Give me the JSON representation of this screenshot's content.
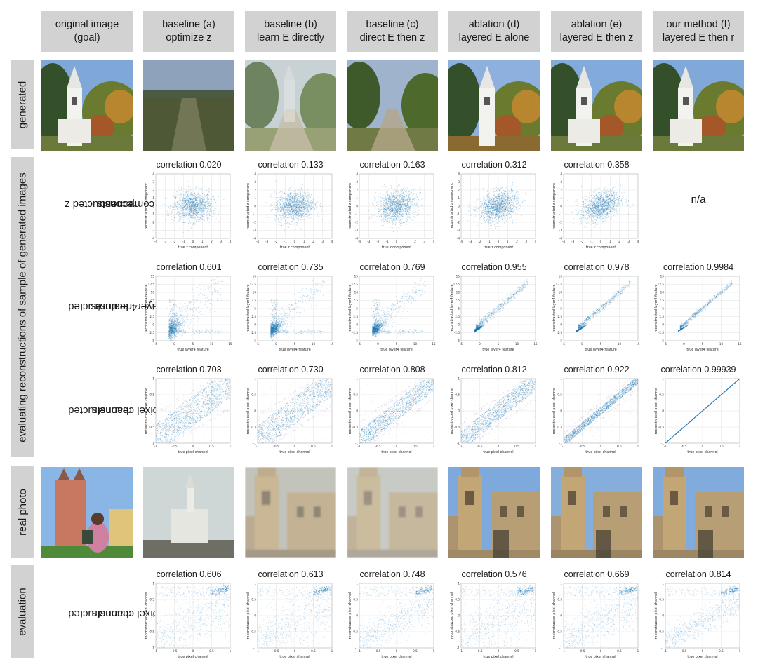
{
  "headers": [
    {
      "line1": "original image",
      "line2": "(goal)"
    },
    {
      "line1": "baseline (a)",
      "line2": "optimize z"
    },
    {
      "line1": "baseline (b)",
      "line2": "learn E directly"
    },
    {
      "line1": "baseline (c)",
      "line2": "direct E then z"
    },
    {
      "line1": "ablation (d)",
      "line2": "layered E alone"
    },
    {
      "line1": "ablation (e)",
      "line2": "layered E then z"
    },
    {
      "line1": "our method (f)",
      "line2": "layered E then r"
    }
  ],
  "row_labels": {
    "generated": "generated",
    "evaluating": "evaluating reconstructions of sample of generated images",
    "real_photo": "real photo",
    "evaluation": "evaluation"
  },
  "sub_labels": {
    "z": [
      "reconstructed z",
      "components"
    ],
    "layer4": [
      "reconstructed",
      "layer4 features"
    ],
    "pixel": [
      "reconstructed",
      "pixel channels"
    ],
    "eval_pixel": [
      "reconstructed",
      "pixel channels"
    ]
  },
  "na_text": "n/a",
  "axis_labels": {
    "z": {
      "x": "true z component",
      "y": "reconstructed z component"
    },
    "layer4": {
      "x": "true layer4 feature",
      "y": "reconstructed layer4 feature"
    },
    "pixel": {
      "x": "true pixel channel",
      "y": "reconstructed pixel channel"
    }
  },
  "colors": {
    "point": "#1f77b4",
    "grey_cloud": "#999999",
    "purple_fringe": "#a070c8",
    "label_bg": "#d2d2d2"
  },
  "chart_data": [
    {
      "type": "scatter",
      "row": "reconstructed z components",
      "xlim": [
        -4,
        4
      ],
      "ylim": [
        -4,
        4
      ],
      "x_ticks": [
        -4,
        -3,
        -2,
        -1,
        0,
        1,
        2,
        3,
        4
      ],
      "y_ticks": [
        -4,
        -3,
        -2,
        -1,
        0,
        1,
        2,
        3,
        4
      ],
      "series": [
        {
          "method": "a",
          "correlation": "correlation 0.020",
          "value": 0.02
        },
        {
          "method": "b",
          "correlation": "correlation 0.133",
          "value": 0.133
        },
        {
          "method": "c",
          "correlation": "correlation 0.163",
          "value": 0.163
        },
        {
          "method": "d",
          "correlation": "correlation 0.312",
          "value": 0.312
        },
        {
          "method": "e",
          "correlation": "correlation 0.358",
          "value": 0.358
        }
      ]
    },
    {
      "type": "scatter",
      "row": "reconstructed layer4 features",
      "xlim": [
        -5,
        15
      ],
      "ylim": [
        -5,
        15
      ],
      "x_ticks": [
        -5,
        0,
        5,
        10,
        15
      ],
      "y_ticks": [
        -5.0,
        -2.5,
        0.0,
        2.5,
        5.0,
        7.5,
        10.0,
        12.5,
        15.0
      ],
      "series": [
        {
          "method": "a",
          "correlation": "correlation 0.601",
          "value": 0.601
        },
        {
          "method": "b",
          "correlation": "correlation 0.735",
          "value": 0.735
        },
        {
          "method": "c",
          "correlation": "correlation 0.769",
          "value": 0.769
        },
        {
          "method": "d",
          "correlation": "correlation 0.955",
          "value": 0.955
        },
        {
          "method": "e",
          "correlation": "correlation 0.978",
          "value": 0.978
        },
        {
          "method": "f",
          "correlation": "correlation 0.9984",
          "value": 0.9984
        }
      ]
    },
    {
      "type": "scatter",
      "row": "reconstructed pixel channels",
      "xlim": [
        -1,
        1
      ],
      "ylim": [
        -1,
        1
      ],
      "x_ticks": [
        -1.0,
        -0.5,
        0.0,
        0.5,
        1.0
      ],
      "y_ticks": [
        -1.0,
        -0.5,
        0.0,
        0.5,
        1.0
      ],
      "series": [
        {
          "method": "a",
          "correlation": "correlation 0.703",
          "value": 0.703
        },
        {
          "method": "b",
          "correlation": "correlation 0.730",
          "value": 0.73
        },
        {
          "method": "c",
          "correlation": "correlation 0.808",
          "value": 0.808
        },
        {
          "method": "d",
          "correlation": "correlation 0.812",
          "value": 0.812
        },
        {
          "method": "e",
          "correlation": "correlation 0.922",
          "value": 0.922
        },
        {
          "method": "f",
          "correlation": "correlation 0.99939",
          "value": 0.99939
        }
      ]
    },
    {
      "type": "scatter",
      "row": "evaluation reconstructed pixel channels",
      "xlim": [
        -1,
        1
      ],
      "ylim": [
        -1,
        1
      ],
      "x_ticks": [
        -1.0,
        -0.5,
        0.0,
        0.5,
        1.0
      ],
      "y_ticks": [
        -1.0,
        -0.5,
        0.0,
        0.5,
        1.0
      ],
      "series": [
        {
          "method": "a",
          "correlation": "correlation 0.606",
          "value": 0.606
        },
        {
          "method": "b",
          "correlation": "correlation 0.613",
          "value": 0.613
        },
        {
          "method": "c",
          "correlation": "correlation 0.748",
          "value": 0.748
        },
        {
          "method": "d",
          "correlation": "correlation 0.576",
          "value": 0.576
        },
        {
          "method": "e",
          "correlation": "correlation 0.669",
          "value": 0.669
        },
        {
          "method": "f",
          "correlation": "correlation 0.814",
          "value": 0.814
        }
      ]
    }
  ],
  "images": {
    "generated": [
      {
        "scene": "white-church-autumn",
        "sky": "#7fa8d8",
        "ground": "#6b7a3a"
      },
      {
        "scene": "blurry-field",
        "sky": "#8fa2bc",
        "ground": "#4e5836"
      },
      {
        "scene": "faded-church-ghost",
        "sky": "#b6c2c6",
        "ground": "#768148"
      },
      {
        "scene": "tree-path",
        "sky": "#9fb4cc",
        "ground": "#6f7a44"
      },
      {
        "scene": "white-tower-autumn",
        "sky": "#8db0de",
        "ground": "#8a6a30"
      },
      {
        "scene": "white-church-autumn",
        "sky": "#82aadb",
        "ground": "#6b7a3a"
      },
      {
        "scene": "white-church-autumn",
        "sky": "#80a9da",
        "ground": "#6b7a3a"
      }
    ],
    "real": [
      {
        "scene": "red-church-person",
        "sky": "#8ab6e6",
        "ground": "#7a6a58"
      },
      {
        "scene": "grey-church",
        "sky": "#cfd6d6",
        "ground": "#8a8a80"
      },
      {
        "scene": "blurry-cathedral",
        "sky": "#b7b8b0",
        "ground": "#8a7860"
      },
      {
        "scene": "ghost-cathedral",
        "sky": "#bcbfbc",
        "ground": "#8e8070"
      },
      {
        "scene": "stone-cathedral",
        "sky": "#7ea9dc",
        "ground": "#a08a66"
      },
      {
        "scene": "stone-cathedral",
        "sky": "#86aedc",
        "ground": "#9a8462"
      },
      {
        "scene": "stone-cathedral",
        "sky": "#80abdc",
        "ground": "#9c8664"
      }
    ]
  }
}
